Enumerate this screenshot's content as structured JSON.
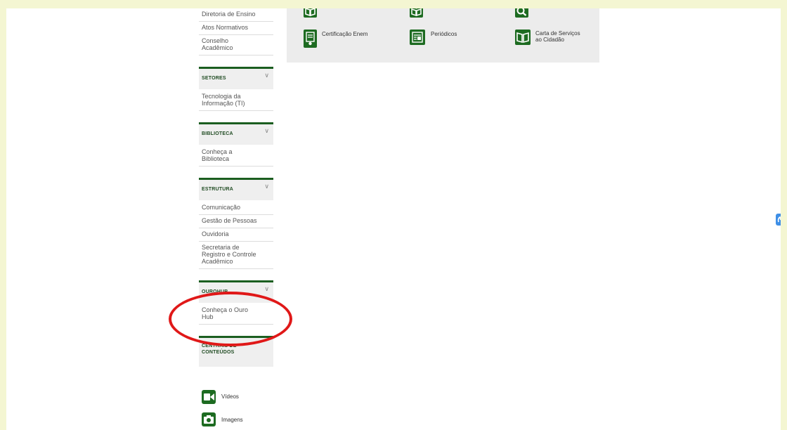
{
  "sidebar": {
    "top_links": [
      "Diretoria de Ensino",
      "Atos Normativos",
      "Conselho\nAcadêmico"
    ],
    "sections": [
      {
        "title": "SETORES",
        "links": [
          "Tecnologia da\nInformação (TI)"
        ]
      },
      {
        "title": "BIBLIOTECA",
        "links": [
          "Conheça a\nBiblioteca"
        ]
      },
      {
        "title": "ESTRUTURA",
        "links": [
          "Comunicação",
          "Gestão de Pessoas",
          "Ouvidoria",
          "Secretaria de\nRegistro e Controle\nAcadêmico"
        ]
      },
      {
        "title": "OUROHUB",
        "links": [
          "Conheça o Ouro\nHub"
        ]
      },
      {
        "title": "CENTRAIS DE\nCONTEÚDOS",
        "links": []
      }
    ],
    "media": [
      {
        "label": "Vídeos",
        "icon": "video-camera-icon"
      },
      {
        "label": "Imagens",
        "icon": "camera-icon"
      }
    ]
  },
  "grid": {
    "items": [
      {
        "label": "",
        "icon": "book-icon"
      },
      {
        "label": "",
        "icon": "reading-icon"
      },
      {
        "label": "",
        "icon": "search-icon"
      },
      {
        "label": "Certificação Enem",
        "icon": "certificate-icon"
      },
      {
        "label": "Periódicos",
        "icon": "newspaper-icon"
      },
      {
        "label": "Carta de Serviços\nao Cidadão",
        "icon": "open-book-icon"
      }
    ]
  },
  "colors": {
    "accent": "#1d6b21",
    "highlight": "#e01818",
    "background": "#f4f6d2",
    "widget": "#3f8fe6"
  },
  "widget": {
    "icon": "accessibility-hands-icon"
  }
}
